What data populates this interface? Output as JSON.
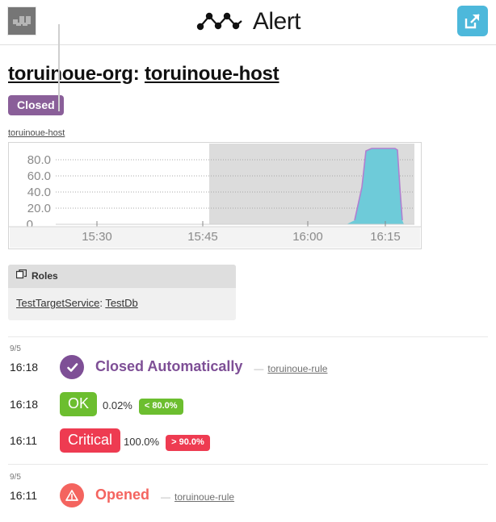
{
  "header": {
    "logo_icon": "mackerel-logo-icon",
    "brand_mark_icon": "alert-zigzag-icon",
    "brand_name": "Alert",
    "external_link_icon": "external-link-icon"
  },
  "alert": {
    "org_name": "toruinoue-org",
    "separator": ": ",
    "host_name": "toruinoue-host",
    "status_label": "Closed",
    "status_color": "#8a5f99"
  },
  "graph": {
    "caption": "toruinoue-host"
  },
  "chart_data": {
    "type": "area",
    "title": "toruinoue-host",
    "xlabel": "",
    "ylabel": "",
    "ylim": [
      0,
      100
    ],
    "ytick_labels": [
      "0",
      "20.0",
      "40.0",
      "60.0",
      "80.0"
    ],
    "ytick_values": [
      0,
      20,
      40,
      60,
      80
    ],
    "xtick_labels": [
      "15:30",
      "15:45",
      "16:00",
      "16:15"
    ],
    "xlim": [
      "15:22",
      "16:19"
    ],
    "grid": true,
    "legend": "none",
    "series": [
      {
        "name": "toruinoue-host",
        "fill_color": "#6ecbd9",
        "line_color": "#b07fd0",
        "x": [
          "15:22",
          "16:05",
          "16:07",
          "16:08",
          "16:09",
          "16:10",
          "16:11",
          "16:13",
          "16:15",
          "16:16",
          "16:17",
          "16:18",
          "16:19"
        ],
        "values": [
          0,
          0,
          0,
          6,
          40,
          88,
          97,
          98,
          98,
          97,
          60,
          2,
          0
        ]
      }
    ],
    "shaded_region": {
      "from": "15:46",
      "to": "16:19",
      "color": "#dcdcdc",
      "note": "alert period shading"
    }
  },
  "roles": {
    "panel_title": "Roles",
    "panel_icon": "tag-icon",
    "service_name": "TestTargetService",
    "separator": ": ",
    "role_name": "TestDb"
  },
  "timeline": {
    "groups": [
      {
        "date": "9/5",
        "events": [
          {
            "time": "16:18",
            "kind": "status",
            "icon": "check-circle-icon",
            "icon_color": "#7e4f96",
            "label": "Closed Automatically",
            "label_color": "#7e4f96",
            "dash": "—",
            "rule": "toruinoue-rule"
          },
          {
            "time": "16:18",
            "kind": "metric",
            "level": "OK",
            "level_color": "#6cbe2f",
            "value": "0.02%",
            "threshold": "< 80.0%"
          },
          {
            "time": "16:11",
            "kind": "metric",
            "level": "Critical",
            "level_color": "#ee3b51",
            "value": "100.0%",
            "threshold": "> 90.0%"
          }
        ]
      },
      {
        "date": "9/5",
        "events": [
          {
            "time": "16:11",
            "kind": "status",
            "icon": "warning-circle-icon",
            "icon_color": "#f4645f",
            "label": "Opened",
            "label_color": "#f4645f",
            "dash": "—",
            "rule": "toruinoue-rule"
          }
        ]
      }
    ]
  }
}
